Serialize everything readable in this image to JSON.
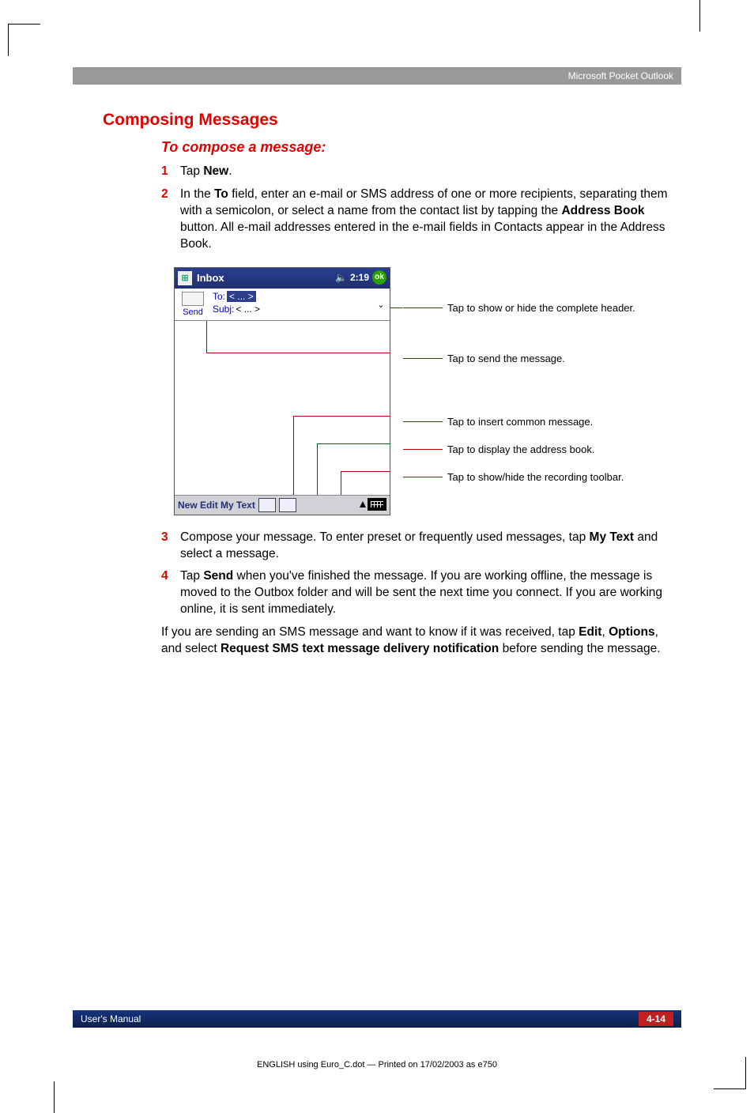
{
  "header": {
    "section": "Microsoft Pocket Outlook"
  },
  "headings": {
    "main": "Composing Messages",
    "sub": "To compose a message:"
  },
  "steps": [
    {
      "num": "1",
      "pre": "Tap ",
      "bold1": "New",
      "post": "."
    },
    {
      "num": "2",
      "p1": "In the ",
      "b1": "To",
      "p2": " field, enter an e-mail or SMS address of one or more recipients, separating them with a semicolon, or select a name from the contact list by tapping the ",
      "b2": "Address Book",
      "p3": " button. All e-mail addresses entered in the e-mail fields in Contacts appear in the Address Book."
    },
    {
      "num": "3",
      "p1": "Compose your message. To enter preset or frequently used messages, tap ",
      "b1": "My Text",
      "p2": " and select a message."
    },
    {
      "num": "4",
      "p1": "Tap ",
      "b1": "Send",
      "p2": " when you've finished the message. If you are working offline, the message is moved to the Outbox folder and will be sent the next time you connect. If you are working online, it is sent immediately."
    }
  ],
  "device": {
    "title": "Inbox",
    "clock": "2:19",
    "ok": "ok",
    "send": "Send",
    "to_label": "To:",
    "to_value": "< ... >",
    "subj_label": "Subj:",
    "subj_value": "< ... >",
    "menu": [
      "New",
      "Edit",
      "My Text"
    ]
  },
  "callouts": [
    "Tap to show or hide the complete header.",
    "Tap to send the message.",
    "Tap to insert common message.",
    "Tap to display the address book.",
    "Tap to show/hide the recording toolbar."
  ],
  "closing": {
    "p1": "If you are sending an SMS message and want to know if it was received, tap ",
    "b1": "Edit",
    "c1": ", ",
    "b2": "Options",
    "c2": ", and select ",
    "b3": "Request SMS text message delivery notification",
    "p2": " before sending the message."
  },
  "footer": {
    "left": "User's Manual",
    "page": "4-14",
    "print": "ENGLISH using Euro_C.dot — Printed on 17/02/2003 as e750"
  }
}
